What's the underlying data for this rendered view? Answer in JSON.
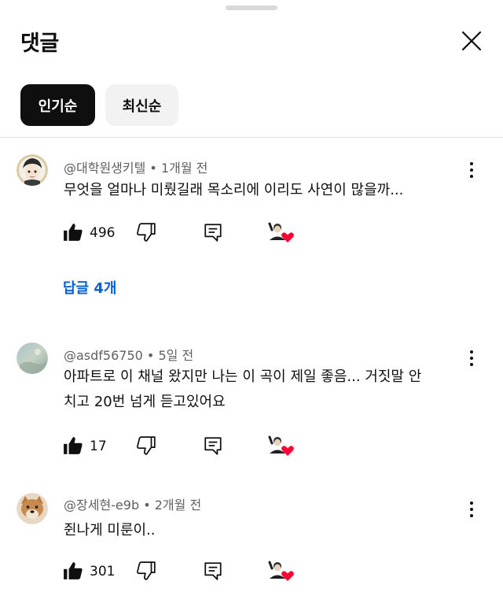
{
  "header": {
    "title": "댓글"
  },
  "sort_chips": [
    {
      "label": "인기순",
      "active": true
    },
    {
      "label": "최신순",
      "active": false
    }
  ],
  "comments": [
    {
      "author": "@대학원생키텔",
      "time": "1개월 전",
      "text_lines": [
        "무엇을 얼마나 미뤘길래 목소리에 이리도 사연이 많을까..."
      ],
      "likes": "496",
      "replies_label": "답글 4개",
      "avatar": "anime-avatar"
    },
    {
      "author": "@asdf56750",
      "time": "5일 전",
      "text_lines": [
        "아파트로 이 채널 왔지만 나는 이 곡이 제일 좋음... 거짓말 안",
        "치고 20번 넘게 듣고있어요"
      ],
      "likes": "17",
      "avatar": "landscape-avatar"
    },
    {
      "author": "@장세현-e9b",
      "time": "2개월 전",
      "text_lines": [
        "쥔나게 미룬이.."
      ],
      "likes": "301",
      "avatar": "dog-avatar"
    }
  ],
  "colors": {
    "accent_link": "#065fd4",
    "heart": "#ff0033",
    "chip_active_bg": "#0f0f0f"
  },
  "icons": [
    "close-icon",
    "thumb-up-icon",
    "thumb-down-icon",
    "reply-comment-icon",
    "creator-heart-icon",
    "more-vert-icon"
  ]
}
